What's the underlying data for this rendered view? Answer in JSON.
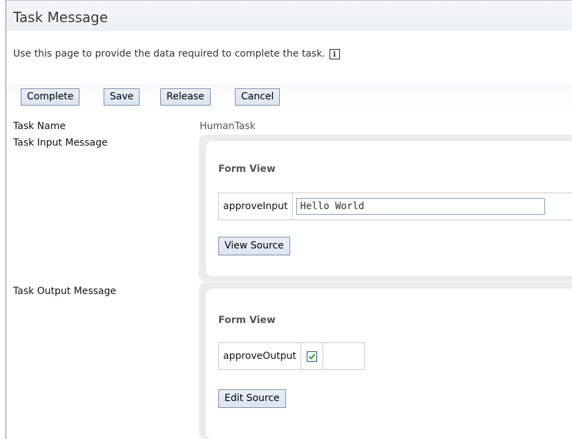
{
  "page": {
    "title": "Task Message",
    "description": "Use this page to provide the data required to complete the task.",
    "info_icon_glyph": "i"
  },
  "toolbar": {
    "complete_label": "Complete",
    "save_label": "Save",
    "release_label": "Release",
    "cancel_label": "Cancel"
  },
  "task": {
    "name_label": "Task Name",
    "name_value": "HumanTask",
    "input_label": "Task Input Message",
    "output_label": "Task Output Message"
  },
  "input_panel": {
    "heading": "Form View",
    "field_name": "approveInput",
    "field_value": "Hello World",
    "source_button": "View Source"
  },
  "output_panel": {
    "heading": "Form View",
    "field_name": "approveOutput",
    "checked": true,
    "source_button": "Edit Source"
  },
  "colors": {
    "button_border": "#7d8ea8",
    "panel_background": "#ebebeb",
    "checkmark": "#2e9a2e"
  }
}
